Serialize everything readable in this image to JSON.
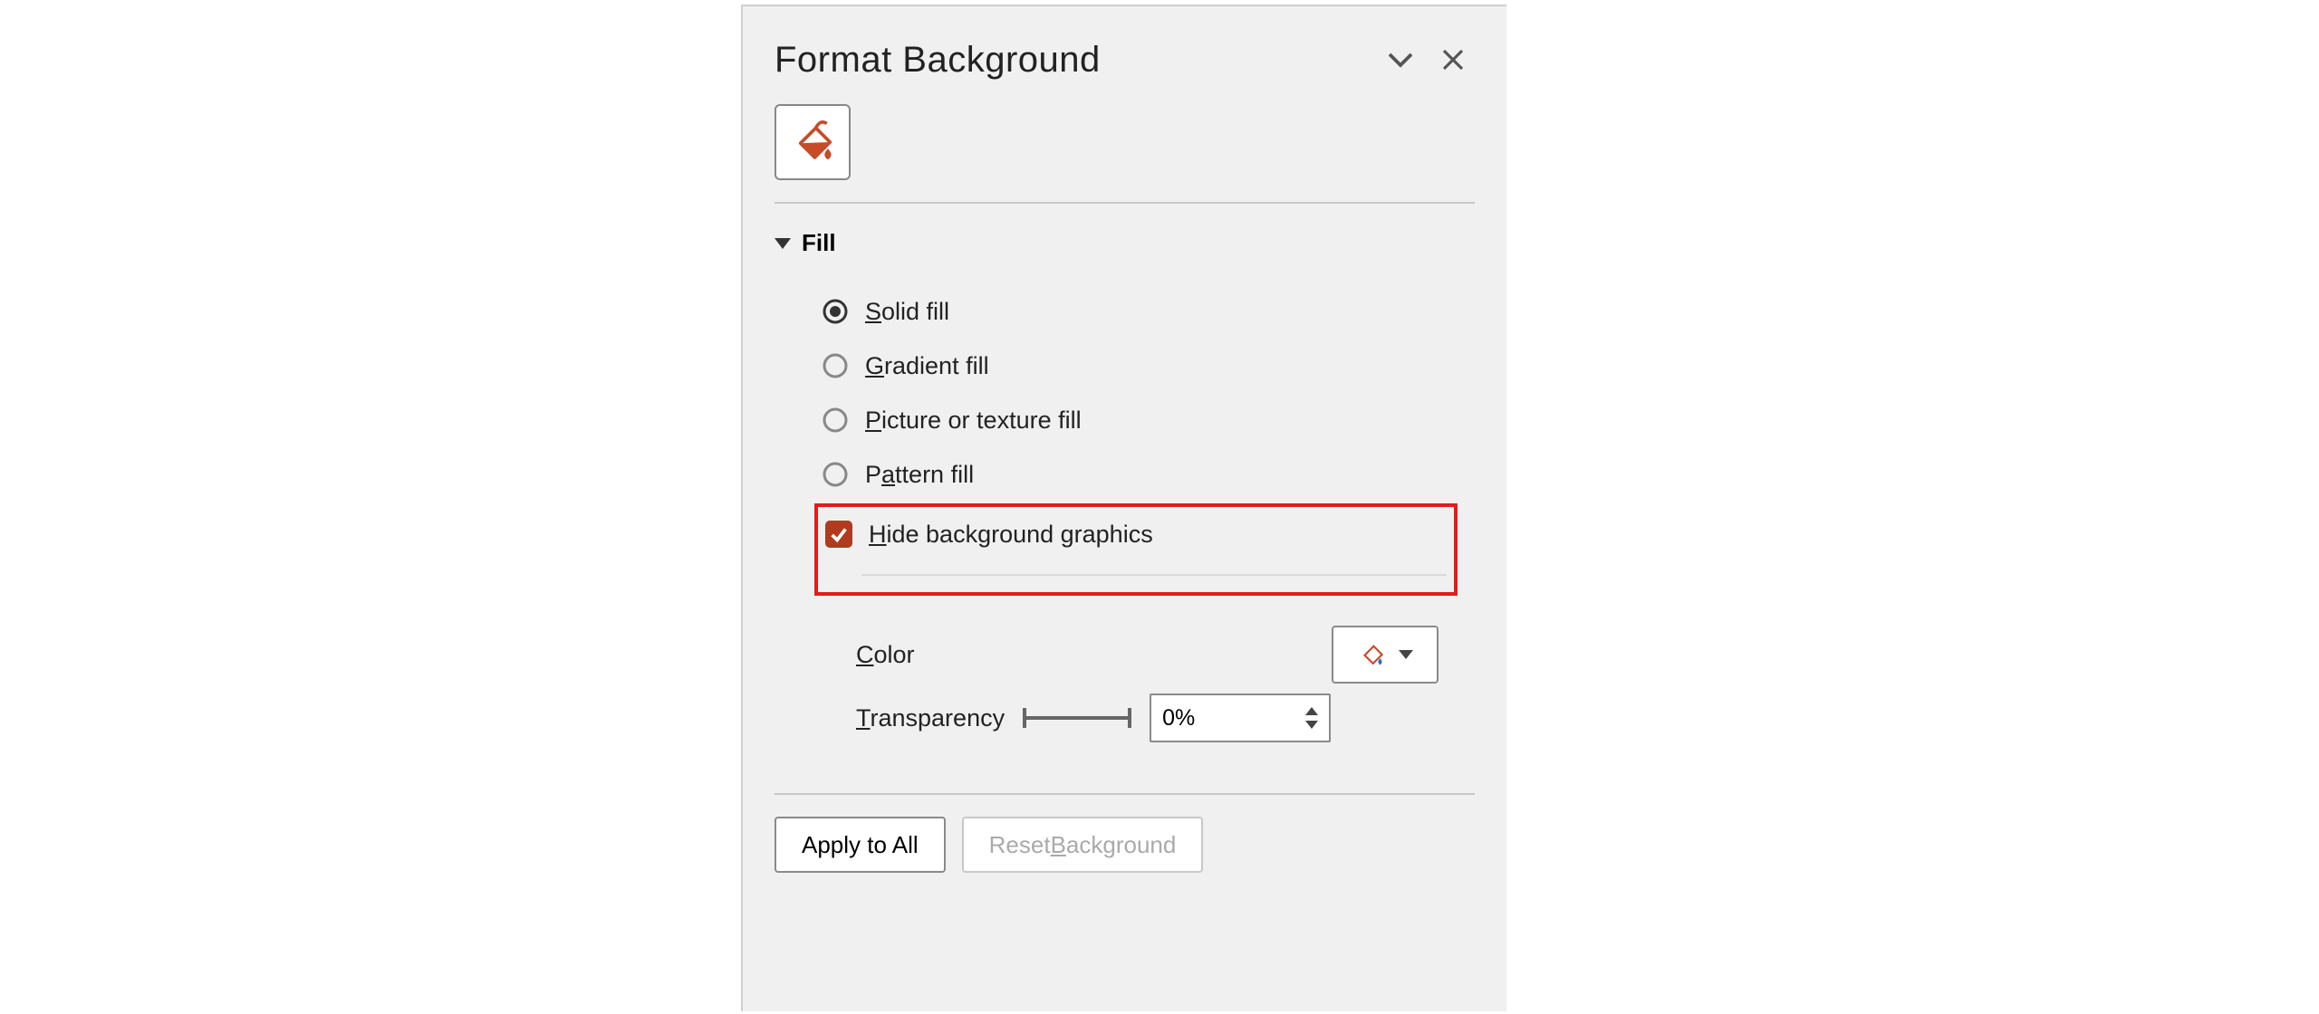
{
  "pane": {
    "title": "Format Background",
    "tab_icon": "paint-bucket-icon"
  },
  "fill": {
    "section_label": "Fill",
    "options": {
      "solid": {
        "prefix": "S",
        "rest": "olid fill",
        "selected": true
      },
      "gradient": {
        "prefix": "G",
        "rest": "radient fill",
        "selected": false
      },
      "picture": {
        "prefix": "P",
        "rest": "icture or texture fill",
        "selected": false
      },
      "pattern": {
        "pre": "P",
        "mid": "a",
        "post": "ttern fill",
        "selected": false
      }
    },
    "hide_bg": {
      "prefix": "H",
      "rest": "ide background graphics",
      "checked": true
    }
  },
  "controls": {
    "color": {
      "prefix": "C",
      "rest": "olor"
    },
    "transparency": {
      "prefix": "T",
      "rest": "ransparency",
      "value": "0%"
    }
  },
  "footer": {
    "apply_all": "Apply to All",
    "reset": {
      "pre": "Reset ",
      "mid": "B",
      "post": "ackground"
    }
  },
  "colors": {
    "accent": "#b03b1e",
    "highlight_border": "#e61a1a"
  }
}
